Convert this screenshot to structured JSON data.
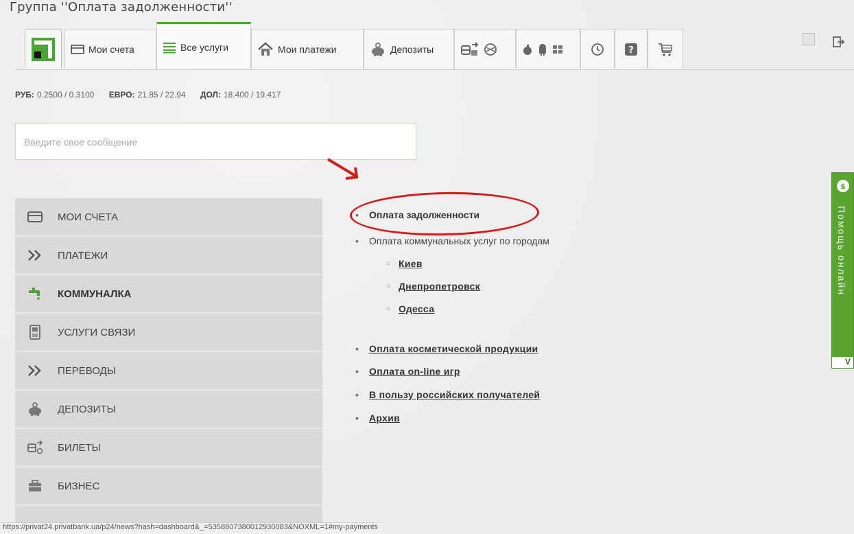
{
  "caption": "Группа ''Оплата задолженности''",
  "tabs": [
    {
      "label": "Мои счета",
      "icon": "card-icon"
    },
    {
      "label": "Все услуги",
      "icon": "list-icon",
      "active": true
    },
    {
      "label": "Мои платежи",
      "icon": "house-icon"
    },
    {
      "label": "Депозиты",
      "icon": "piggy-bank-icon"
    }
  ],
  "rates": {
    "rub_label": "РУБ:",
    "rub_value": "0.2500 / 0.3100",
    "eur_label": "ЕВРО:",
    "eur_value": "21.85 / 22.94",
    "usd_label": "ДОЛ:",
    "usd_value": "18.400 / 19.417"
  },
  "message": {
    "placeholder": "Введите свое сообщение"
  },
  "sidebar": {
    "items": [
      {
        "label": "МОИ СЧЕТА",
        "icon": "card-icon"
      },
      {
        "label": "ПЛАТЕЖИ",
        "icon": "double-chevron-icon"
      },
      {
        "label": "КОММУНАЛКА",
        "icon": "faucet-icon",
        "active": true
      },
      {
        "label": "УСЛУГИ СВЯЗИ",
        "icon": "phone-icon"
      },
      {
        "label": "ПЕРЕВОДЫ",
        "icon": "double-chevron-icon"
      },
      {
        "label": "ДЕПОЗИТЫ",
        "icon": "piggy-bank-icon"
      },
      {
        "label": "БИЛЕТЫ",
        "icon": "train-icon"
      },
      {
        "label": "БИЗНЕС",
        "icon": "briefcase-icon"
      }
    ]
  },
  "content": {
    "debt": "Оплата задолженности",
    "communal": "Оплата коммунальных услуг по городам",
    "cities": [
      "Киев",
      "Днепропетровск",
      "Одесса"
    ],
    "cosmetics": "Оплата косметической продукции",
    "games": "Оплата on-line игр",
    "russian": "В пользу российских получателей",
    "archive": "Архив"
  },
  "help": {
    "label": "Помощь онлайн",
    "badge": "$",
    "collapse": "V"
  },
  "status_url": "https://privat24.privatbank.ua/p24/news?hash=dashboard&_=5358807380012930083&NOXML=1#my-payments",
  "colors": {
    "accent": "#4fa336",
    "highlight": "#d61919",
    "logo": "#4ca338"
  }
}
